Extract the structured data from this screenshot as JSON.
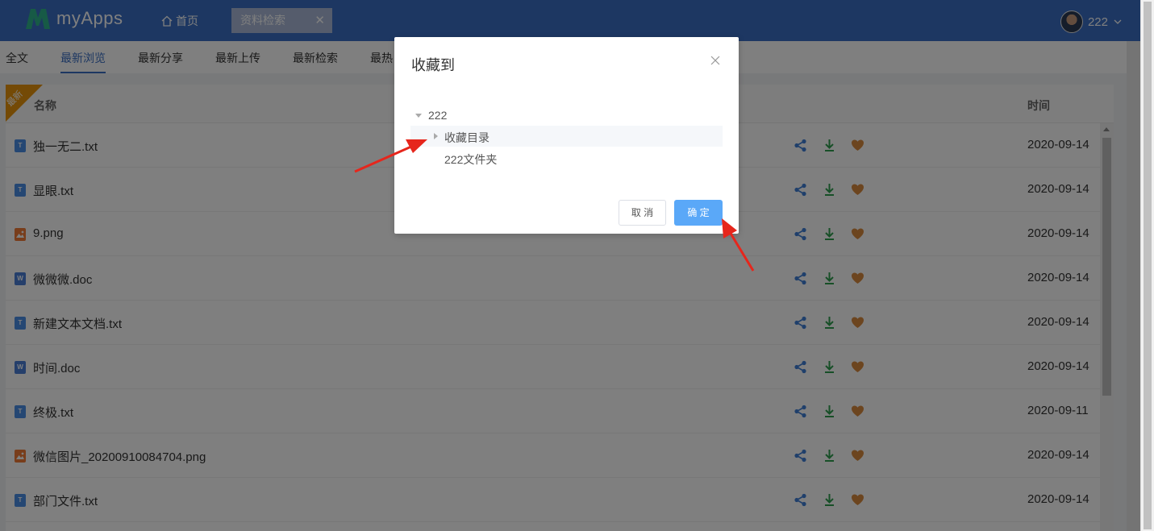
{
  "header": {
    "app_name": "myApps",
    "home_label": "首页",
    "open_tab_label": "资料检索",
    "open_tab_close": "✕",
    "user_name": "222"
  },
  "tabs": [
    {
      "label": "全文",
      "active": false
    },
    {
      "label": "最新浏览",
      "active": true
    },
    {
      "label": "最新分享",
      "active": false
    },
    {
      "label": "最新上传",
      "active": false
    },
    {
      "label": "最新检索",
      "active": false
    },
    {
      "label": "最热",
      "active": false
    }
  ],
  "table": {
    "ribbon": "最新",
    "col_name": "名称",
    "col_time": "时间",
    "rows": [
      {
        "name": "独一无二.txt",
        "type": "txt",
        "icon_letter": "T",
        "time": "2020-09-14"
      },
      {
        "name": "显眼.txt",
        "type": "txt",
        "icon_letter": "T",
        "time": "2020-09-14"
      },
      {
        "name": "9.png",
        "type": "png",
        "icon_letter": "",
        "time": "2020-09-14"
      },
      {
        "name": "微微微.doc",
        "type": "doc",
        "icon_letter": "W",
        "time": "2020-09-14"
      },
      {
        "name": "新建文本文档.txt",
        "type": "txt",
        "icon_letter": "T",
        "time": "2020-09-14"
      },
      {
        "name": "时间.doc",
        "type": "doc",
        "icon_letter": "W",
        "time": "2020-09-14"
      },
      {
        "name": "终极.txt",
        "type": "txt",
        "icon_letter": "T",
        "time": "2020-09-11"
      },
      {
        "name": "微信图片_20200910084704.png",
        "type": "png",
        "icon_letter": "",
        "time": "2020-09-14"
      },
      {
        "name": "部门文件.txt",
        "type": "txt",
        "icon_letter": "T",
        "time": "2020-09-14"
      }
    ]
  },
  "dialog": {
    "title": "收藏到",
    "tree_root": "222",
    "tree_children": [
      "收藏目录",
      "222文件夹"
    ],
    "cancel_label": "取 消",
    "ok_label": "确 定"
  },
  "colors": {
    "header": "#3b6fc4",
    "share": "#3f7fd6",
    "download": "#2e9e4e",
    "favorite": "#d98a3e",
    "primary_button": "#5aa8f8",
    "annotation_arrow": "#e6261c"
  }
}
